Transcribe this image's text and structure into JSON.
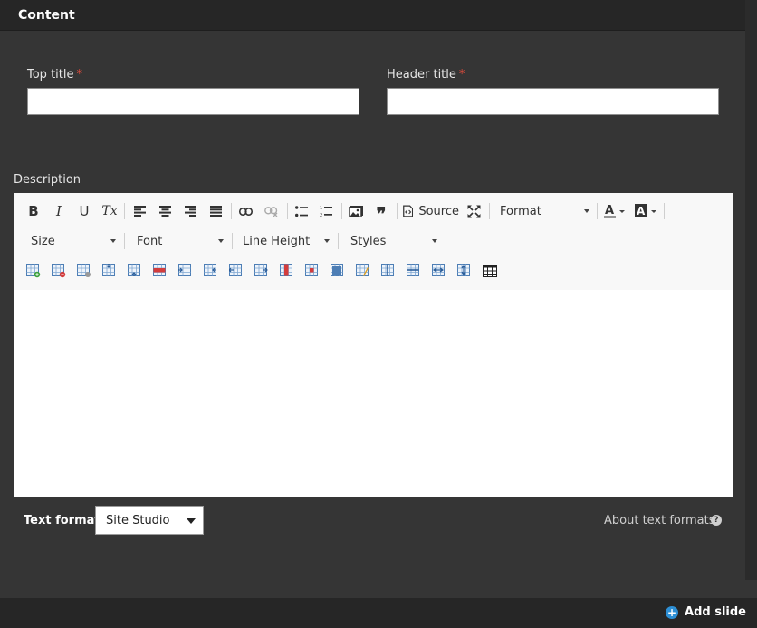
{
  "panel": {
    "title": "Content"
  },
  "fields": {
    "top_title": {
      "label": "Top title",
      "required_mark": "*",
      "value": ""
    },
    "header_title": {
      "label": "Header title",
      "required_mark": "*",
      "value": ""
    },
    "description": {
      "label": "Description"
    }
  },
  "toolbar": {
    "row1": {
      "bold": "B",
      "italic": "I",
      "underline": "U",
      "remove_format": "Tx",
      "source_label": "Source",
      "format_label": "Format",
      "icons": [
        "bold-icon",
        "italic-icon",
        "underline-icon",
        "remove-format-icon",
        "align-left-icon",
        "align-center-icon",
        "align-right-icon",
        "align-justify-icon",
        "link-icon",
        "unlink-icon",
        "bulleted-list-icon",
        "numbered-list-icon",
        "image-icon",
        "blockquote-icon",
        "source-icon",
        "maximize-icon",
        "text-color-icon",
        "background-color-icon"
      ]
    },
    "row2": {
      "size_label": "Size",
      "font_label": "Font",
      "line_height_label": "Line Height",
      "styles_label": "Styles"
    },
    "row3": {
      "icons": [
        "insert-row-icon",
        "delete-row-icon",
        "table-properties-icon",
        "insert-row-before-icon",
        "insert-row-after-icon",
        "delete-row-alt-icon",
        "insert-column-before-icon",
        "insert-column-after-icon",
        "move-column-left-icon",
        "move-column-right-icon",
        "delete-column-icon",
        "delete-cell-icon",
        "merge-cells-icon",
        "cell-properties-icon",
        "split-cell-vertical-icon",
        "split-cell-horizontal-icon",
        "merge-right-icon",
        "merge-down-icon",
        "table-icon"
      ]
    }
  },
  "text_format": {
    "label": "Text format",
    "selected": "Site Studio",
    "about_link": "About text formats",
    "help_glyph": "?"
  },
  "footer": {
    "add_slide_label": "Add slide",
    "plus_glyph": "+"
  },
  "colors": {
    "accent": "#2d8fd5",
    "required": "#e74c3c",
    "panel_bg": "#353535",
    "header_bg": "#262626"
  }
}
